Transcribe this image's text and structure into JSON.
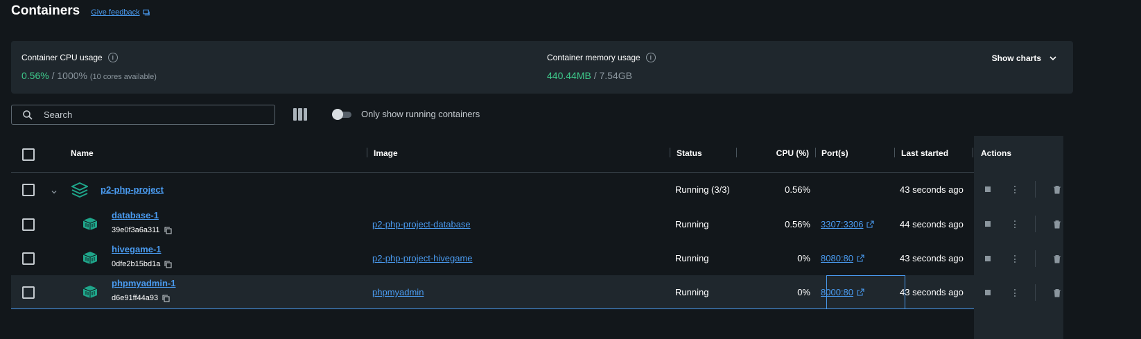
{
  "header": {
    "title": "Containers",
    "feedback_label": "Give feedback"
  },
  "stats": {
    "cpu": {
      "label": "Container CPU usage",
      "used": "0.56%",
      "sep": " / ",
      "total": "1000%",
      "note": "(10 cores available)"
    },
    "memory": {
      "label": "Container memory usage",
      "used": "440.44MB",
      "sep": " / ",
      "total": "7.54GB"
    },
    "show_charts_label": "Show charts"
  },
  "toolbar": {
    "search_placeholder": "Search",
    "toggle_label": "Only show running containers",
    "toggle_on": false
  },
  "table": {
    "columns": {
      "name": "Name",
      "image": "Image",
      "status": "Status",
      "cpu": "CPU (%)",
      "ports": "Port(s)",
      "last_started": "Last started",
      "actions": "Actions"
    },
    "project": {
      "name": "p2-php-project",
      "status": "Running (3/3)",
      "cpu": "0.56%",
      "last_started": "43 seconds ago"
    },
    "containers": [
      {
        "name": "database-1",
        "id": "39e0f3a6a311",
        "image": "p2-php-project-database",
        "status": "Running",
        "cpu": "0.56%",
        "port": "3307:3306",
        "last_started": "44 seconds ago"
      },
      {
        "name": "hivegame-1",
        "id": "0dfe2b15bd1a",
        "image": "p2-php-project-hivegame",
        "status": "Running",
        "cpu": "0%",
        "port": "8080:80",
        "last_started": "43 seconds ago"
      },
      {
        "name": "phpmyadmin-1",
        "id": "d6e91ff44a93",
        "image": "phpmyadmin",
        "status": "Running",
        "cpu": "0%",
        "port": "8000:80",
        "last_started": "43 seconds ago"
      }
    ]
  },
  "colors": {
    "accent": "#4a9bf0",
    "green": "#3ec98b",
    "icon_teal": "#1fa58a",
    "background": "#12171b",
    "panel": "#1f272d"
  },
  "icons": {
    "info": "info-icon",
    "chevron": "chevron-down-icon",
    "search": "search-icon",
    "columns": "columns-icon",
    "copy": "copy-icon",
    "external": "external-link-icon",
    "stop": "stop-icon",
    "more": "more-icon",
    "trash": "trash-icon",
    "stack": "stack-icon",
    "container": "container-icon"
  }
}
